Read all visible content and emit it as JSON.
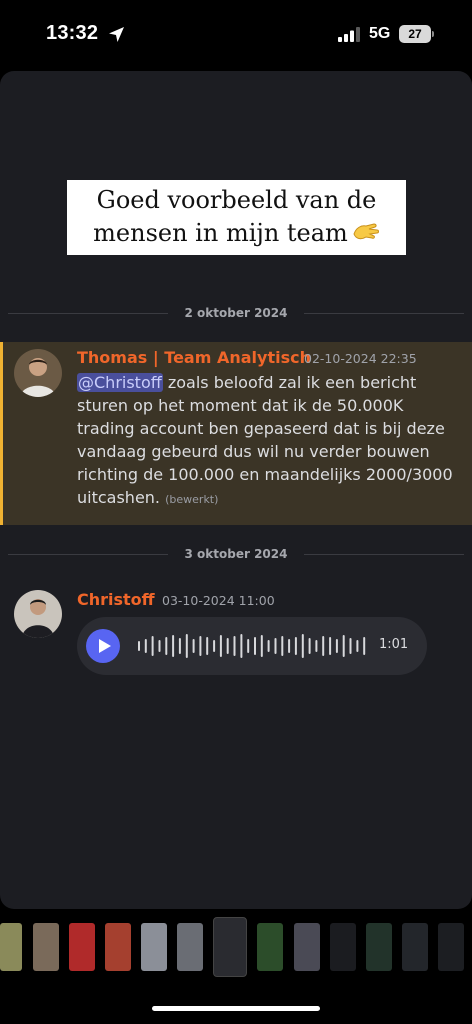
{
  "status_bar": {
    "time": "13:32",
    "network": "5G",
    "battery": "27"
  },
  "post": {
    "caption_line1": "Goed voorbeeld van de",
    "caption_line2": "mensen in mijn team",
    "caption_emoji": "pinching-hand-icon"
  },
  "chat": {
    "date_divider_1": "2 oktober 2024",
    "message_1": {
      "author": "Thomas | Team Analytisch",
      "timestamp": "02-10-2024 22:35",
      "mention": "@Christoff",
      "text": " zoals beloofd zal ik een bericht sturen op het moment dat ik de 50.000K trading account ben gepaseerd dat is bij deze vandaag gebeurd dus wil nu verder bouwen richting de 100.000 en maandelijks 2000/3000 uitcashen.",
      "edited": "(bewerkt)"
    },
    "date_divider_2": "3 oktober 2024",
    "message_2": {
      "author": "Christoff",
      "timestamp": "03-10-2024 11:00",
      "voice_duration": "1:01"
    }
  },
  "colors": {
    "accent": "#5865f2",
    "author": "#f0662a",
    "highlight": "#3b3426",
    "highlight_bar": "#f0b232"
  }
}
